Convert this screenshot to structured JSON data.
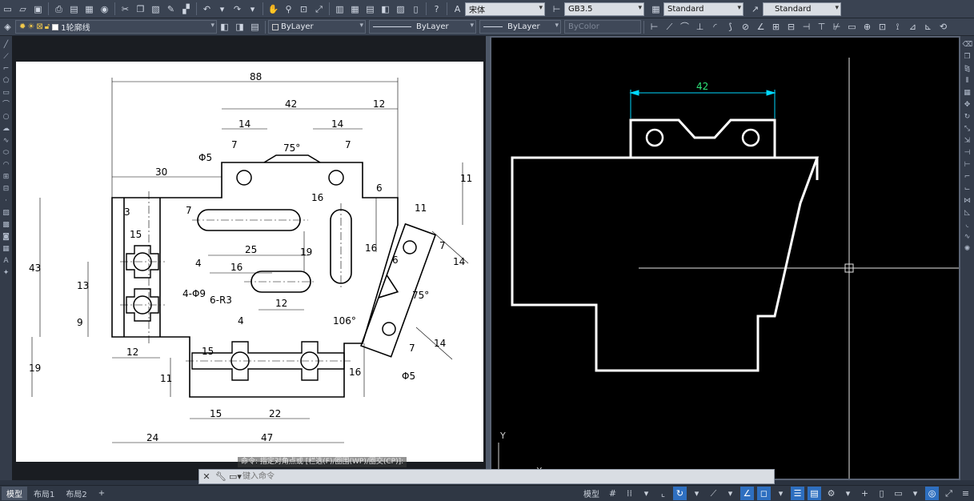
{
  "toolbar1": {
    "text_style": "宋体",
    "dim_style": "GB3.5",
    "table_style": "Standard",
    "multileader_style": "Standard"
  },
  "toolbar2": {
    "layer": "1轮廓线",
    "color": "ByLayer",
    "linetype": "ByLayer",
    "lineweight": "ByLayer",
    "plotstyle": "ByColor"
  },
  "drawing_left": {
    "dims": {
      "d88": "88",
      "d42": "42",
      "d12a": "12",
      "d14a": "14",
      "d14b": "14",
      "d7a": "7",
      "d7b": "7",
      "d75a": "75°",
      "d30": "30",
      "phi5a": "Φ5",
      "d6a": "6",
      "d11a": "11",
      "d16a": "16",
      "d7c": "7",
      "d3": "3",
      "d15a": "15",
      "d25": "25",
      "d4a": "4",
      "d16b": "16",
      "d19a": "19",
      "d16c": "16",
      "d43": "43",
      "d13": "13",
      "d9": "9",
      "holes": "4-Φ9",
      "radii": "6-R3",
      "d12b": "12",
      "d11b": "11",
      "d6b": "6",
      "d7d": "7",
      "d14c": "14",
      "d75b": "75°",
      "d106": "106°",
      "d7e": "7",
      "d14d": "14",
      "phi5b": "Φ5",
      "d4b": "4",
      "d15b": "15",
      "d12c": "12",
      "d19b": "19",
      "d11c": "11",
      "d16d": "16",
      "d15c": "15",
      "d22": "22",
      "d24": "24",
      "d47": "47"
    }
  },
  "drawing_right": {
    "dim": "42",
    "ucs_y": "Y",
    "ucs_x": "X"
  },
  "command": {
    "previous": "命令: 指定对角点或 [栏选(F)/圈围(WP)/圈交(CP)]:",
    "placeholder": "键入命令"
  },
  "tabs": [
    "模型",
    "布局1",
    "布局2"
  ],
  "status": {
    "model": "模型"
  },
  "colors": {
    "dim_cyan": "#00d8ff",
    "dim_green": "#2ee57a",
    "crosshair": "#ffffff"
  }
}
